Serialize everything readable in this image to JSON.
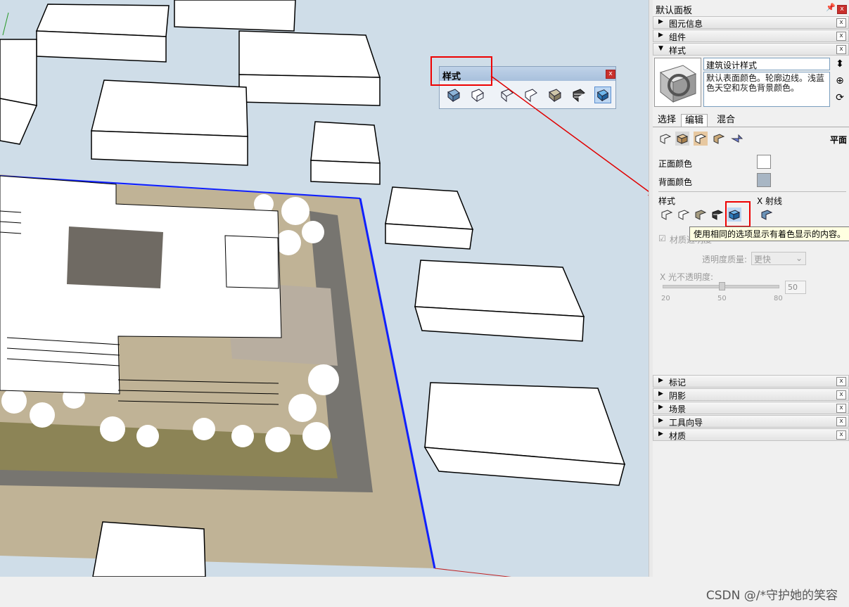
{
  "panel": {
    "title": "默认面板",
    "pin_glyph": "ᵖ",
    "sections_top": [
      {
        "label": "图元信息",
        "arrow": "▶"
      },
      {
        "label": "组件",
        "arrow": "▶"
      },
      {
        "label": "样式",
        "arrow": "▼"
      }
    ],
    "style_name": "建筑设计样式",
    "style_description": "默认表面颜色。轮廓边线。浅蓝色天空和灰色背景颜色。",
    "tabs": [
      "选择",
      "编辑",
      "混合"
    ],
    "active_tab": "编辑",
    "edit_mode_label": "平面",
    "front_color_label": "正面颜色",
    "back_color_label": "背面颜色",
    "front_color": "#ffffff",
    "back_color": "#a8b6c4",
    "style_label": "样式",
    "xray_label": "X 射线",
    "tooltip": "使用相同的选项显示有着色显示的内容。",
    "transparency_checkbox_label": "材质透明度",
    "transparency_quality_label": "透明度质量:",
    "transparency_quality_value": "更快",
    "xray_opacity_label": "X 光不透明度:",
    "xray_opacity_value": "50",
    "slider_ticks": [
      "20",
      "50",
      "80"
    ],
    "sections_bottom": [
      {
        "label": "标记",
        "arrow": "▶"
      },
      {
        "label": "阴影",
        "arrow": "▶"
      },
      {
        "label": "场景",
        "arrow": "▶"
      },
      {
        "label": "工具向导",
        "arrow": "▶"
      },
      {
        "label": "材质",
        "arrow": "▶"
      }
    ],
    "close_glyph": "x"
  },
  "float_toolbar": {
    "title": "样式",
    "close_glyph": "x"
  },
  "watermark": "CSDN @/*守护她的笑容",
  "colors": {
    "sky": "#cfdde8",
    "ground": "#c0b396",
    "accent_red": "#e00000",
    "selection_blue": "#5a8ed0",
    "site_edge": "#1020ff"
  }
}
